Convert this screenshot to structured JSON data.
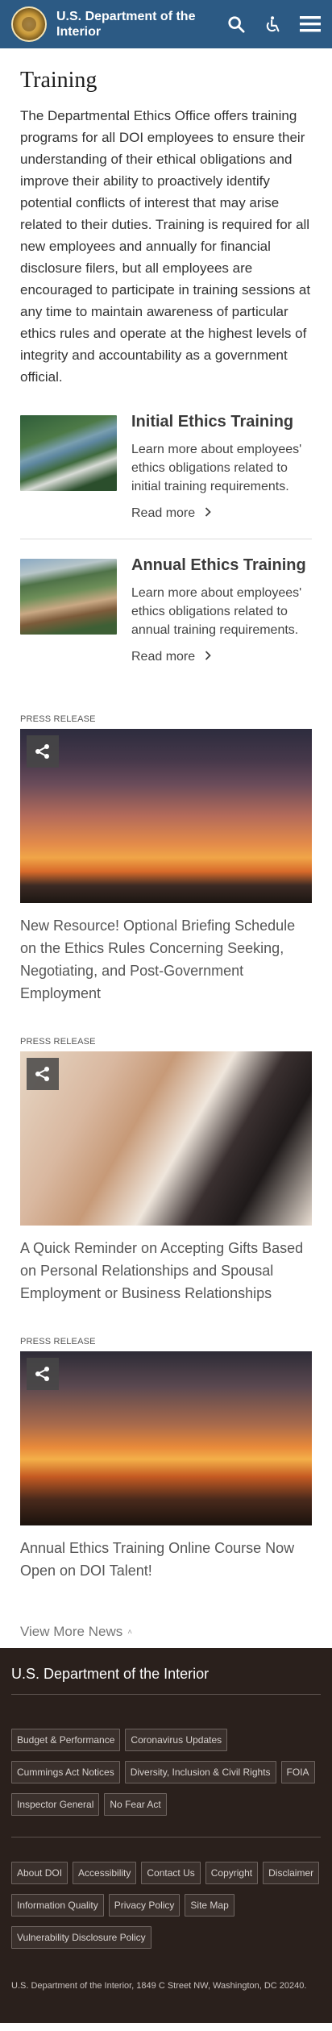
{
  "header": {
    "site_title": "U.S. Department of the Interior",
    "icons": [
      "doi-seal-icon",
      "search-icon",
      "accessibility-icon",
      "menu-icon"
    ],
    "color": "#2c5a84"
  },
  "main": {
    "title": "Training",
    "intro": "The Departmental Ethics Office offers training programs for all DOI employees to ensure their understanding of their ethical obligations and improve their ability to proactively identify potential conflicts of interest that may arise related to their duties.  Training is required for all new employees and annually for financial disclosure filers, but all employees are encouraged to participate in training sessions at any time to maintain awareness of particular ethics rules and operate at the highest levels of integrity and accountability as a government official.",
    "trainings": [
      {
        "title": "Initial Ethics Training",
        "description": "Learn more about employees' ethics obligations related to initial training requirements.",
        "link": "Read more"
      },
      {
        "title": "Annual Ethics Training",
        "description": "Learn more about employees' ethics obligations related to annual training requirements.",
        "link": "Read more"
      }
    ],
    "press_releases": [
      {
        "label": "PRESS RELEASE",
        "title": "New Resource! Optional Briefing Schedule on the Ethics Rules Concerning Seeking, Negotiating, and Post-Government Employment"
      },
      {
        "label": "PRESS RELEASE",
        "title": "A Quick Reminder on Accepting Gifts Based on Personal Relationships and Spousal Employment or Business Relationships"
      },
      {
        "label": "PRESS RELEASE",
        "title": "Annual Ethics Training Online Course Now Open on DOI Talent!"
      }
    ],
    "view_more": "View More News"
  },
  "footer": {
    "title": "U.S. Department of the Interior",
    "links_primary": [
      "Budget & Performance",
      "Coronavirus Updates",
      "Cummings Act Notices",
      "Diversity, Inclusion & Civil Rights",
      "FOIA",
      "Inspector General",
      "No Fear Act"
    ],
    "links_secondary": [
      "About DOI",
      "Accessibility",
      "Contact Us",
      "Copyright",
      "Disclaimer",
      "Information Quality",
      "Privacy Policy",
      "Site Map",
      "Vulnerability Disclosure Policy"
    ],
    "address": "U.S. Department of the Interior, 1849 C Street NW, Washington, DC 20240.",
    "background": "#2a201c"
  }
}
